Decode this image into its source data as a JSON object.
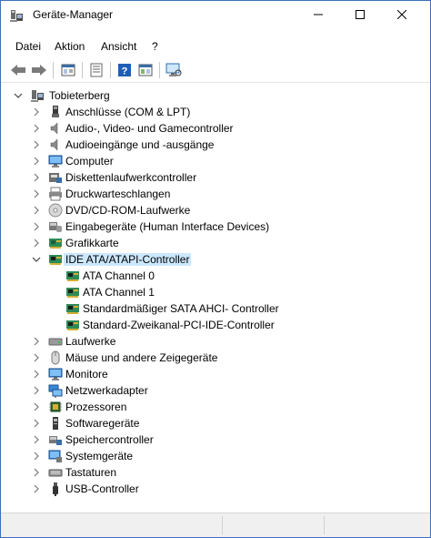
{
  "window": {
    "title": "Geräte-Manager",
    "minimize_glyph": "—",
    "maximize_glyph": "☐",
    "close_glyph": "✕"
  },
  "menu": [
    "Datei",
    "Aktion",
    "Ansicht",
    "?"
  ],
  "toolbar": {
    "buttons": [
      "back-arrow-icon",
      "forward-arrow-icon",
      "show-hide-tree-icon",
      "properties-icon",
      "help-icon",
      "view-icon",
      "monitor-scan-icon"
    ]
  },
  "tree": {
    "root": "Tobieterberg",
    "categories": [
      {
        "label": "Anschlüsse (COM & LPT)",
        "icon": "port-icon"
      },
      {
        "label": "Audio-, Video- und Gamecontroller",
        "icon": "speaker-icon"
      },
      {
        "label": "Audioeingänge und -ausgänge",
        "icon": "speaker-icon"
      },
      {
        "label": "Computer",
        "icon": "computer-icon"
      },
      {
        "label": "Diskettenlaufwerkcontroller",
        "icon": "floppy-controller-icon"
      },
      {
        "label": "Druckwarteschlangen",
        "icon": "printer-icon"
      },
      {
        "label": "DVD/CD-ROM-Laufwerke",
        "icon": "dvd-icon"
      },
      {
        "label": "Eingabegeräte (Human Interface Devices)",
        "icon": "hid-icon"
      },
      {
        "label": "Grafikkarte",
        "icon": "display-adapter-icon"
      },
      {
        "label": "IDE ATA/ATAPI-Controller",
        "icon": "ide-controller-icon",
        "expanded": true,
        "selected": true,
        "children": [
          "ATA Channel 0",
          "ATA Channel 1",
          "Standardmäßiger SATA AHCI- Controller",
          "Standard-Zweikanal-PCI-IDE-Controller"
        ]
      },
      {
        "label": "Laufwerke",
        "icon": "drive-icon"
      },
      {
        "label": "Mäuse und andere Zeigegeräte",
        "icon": "mouse-icon"
      },
      {
        "label": "Monitore",
        "icon": "monitor-icon"
      },
      {
        "label": "Netzwerkadapter",
        "icon": "network-icon"
      },
      {
        "label": "Prozessoren",
        "icon": "processor-icon"
      },
      {
        "label": "Softwaregeräte",
        "icon": "software-device-icon"
      },
      {
        "label": "Speichercontroller",
        "icon": "storage-controller-icon"
      },
      {
        "label": "Systemgeräte",
        "icon": "system-device-icon"
      },
      {
        "label": "Tastaturen",
        "icon": "keyboard-icon"
      },
      {
        "label": "USB-Controller",
        "icon": "usb-icon"
      }
    ]
  },
  "colors": {
    "selection": "#cce8ff",
    "accent": "#0078d7"
  }
}
